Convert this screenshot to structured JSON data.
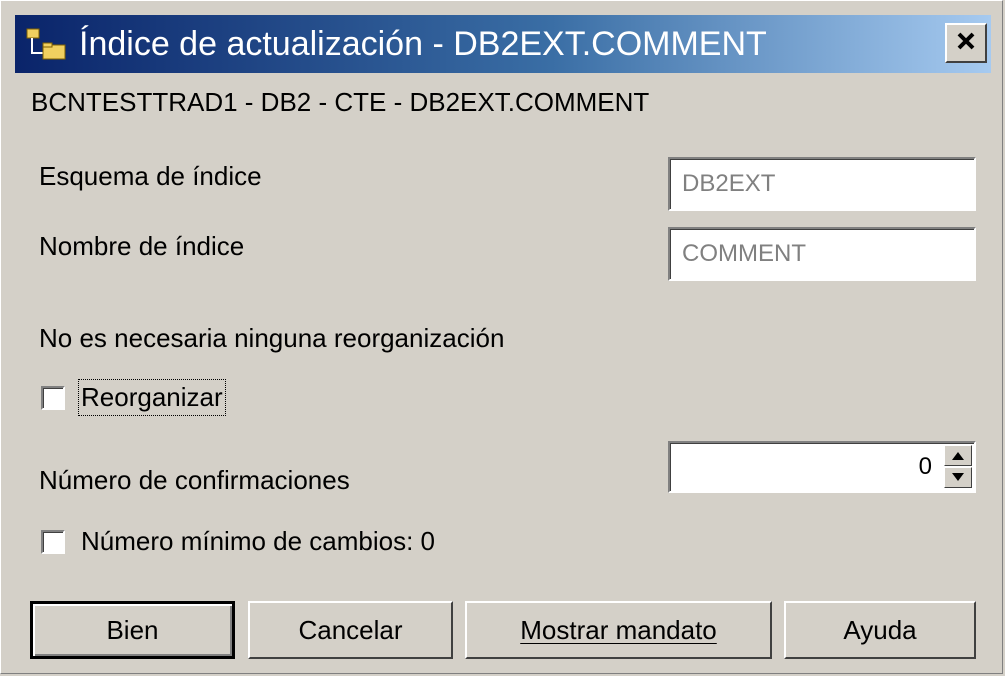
{
  "window": {
    "title": "Índice de actualización - DB2EXT.COMMENT",
    "context": "BCNTESTTRAD1 - DB2 - CTE - DB2EXT.COMMENT"
  },
  "form": {
    "schema_label": "Esquema de índice",
    "schema_value": "DB2EXT",
    "name_label": "Nombre de índice",
    "name_value": "COMMENT",
    "status_text": "No es necesaria ninguna reorganización",
    "reorganize_label": "Reorganizar",
    "reorganize_checked": false,
    "commits_label": "Número de confirmaciones",
    "commits_value": "0",
    "min_changes_label": "Número mínimo de cambios: 0",
    "min_changes_checked": false
  },
  "buttons": {
    "ok": "Bien",
    "cancel": "Cancelar",
    "show_command": "Mostrar mandato",
    "help": "Ayuda"
  },
  "icons": {
    "title": "folder-tree-icon",
    "close": "close-icon",
    "spin_up": "arrow-up-icon",
    "spin_down": "arrow-down-icon"
  },
  "colors": {
    "face": "#d4d0c8",
    "title_start": "#0a246a",
    "title_end": "#a6caf0"
  }
}
